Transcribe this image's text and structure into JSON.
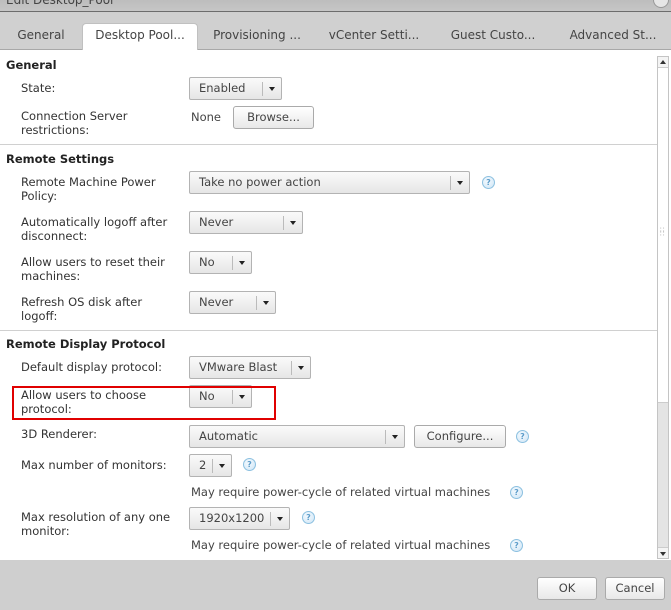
{
  "window": {
    "title": "Edit Desktop_Pool",
    "close_label": "×"
  },
  "tabs": [
    {
      "label": "General",
      "active": false
    },
    {
      "label": "Desktop Pool...",
      "active": true
    },
    {
      "label": "Provisioning ...",
      "active": false
    },
    {
      "label": "vCenter Setti...",
      "active": false
    },
    {
      "label": "Guest Custo...",
      "active": false
    },
    {
      "label": "Advanced St...",
      "active": false
    }
  ],
  "sections": {
    "general": {
      "title": "General",
      "state_label": "State:",
      "state_value": "Enabled",
      "cs_restrictions_label": "Connection Server restrictions:",
      "cs_restrictions_value": "None",
      "browse_label": "Browse..."
    },
    "remote_settings": {
      "title": "Remote Settings",
      "power_policy_label": "Remote Machine Power Policy:",
      "power_policy_value": "Take no power action",
      "auto_logoff_label": "Automatically logoff after disconnect:",
      "auto_logoff_value": "Never",
      "allow_reset_label": "Allow users to reset their machines:",
      "allow_reset_value": "No",
      "refresh_os_label": "Refresh OS disk after logoff:",
      "refresh_os_value": "Never"
    },
    "remote_display": {
      "title": "Remote Display Protocol",
      "default_protocol_label": "Default display protocol:",
      "default_protocol_value": "VMware Blast",
      "allow_choose_label": "Allow users to choose protocol:",
      "allow_choose_value": "No",
      "renderer_label": "3D Renderer:",
      "renderer_value": "Automatic",
      "configure_label": "Configure...",
      "max_monitors_label": "Max number of monitors:",
      "max_monitors_value": "2",
      "power_cycle_note_1": "May require power-cycle of related virtual machines",
      "max_resolution_label": "Max resolution of any one monitor:",
      "max_resolution_value": "1920x1200",
      "power_cycle_note_2": "May require power-cycle of related virtual machines"
    }
  },
  "help_glyph": "?",
  "footer": {
    "ok_label": "OK",
    "cancel_label": "Cancel"
  },
  "highlight_color": "#e00000"
}
